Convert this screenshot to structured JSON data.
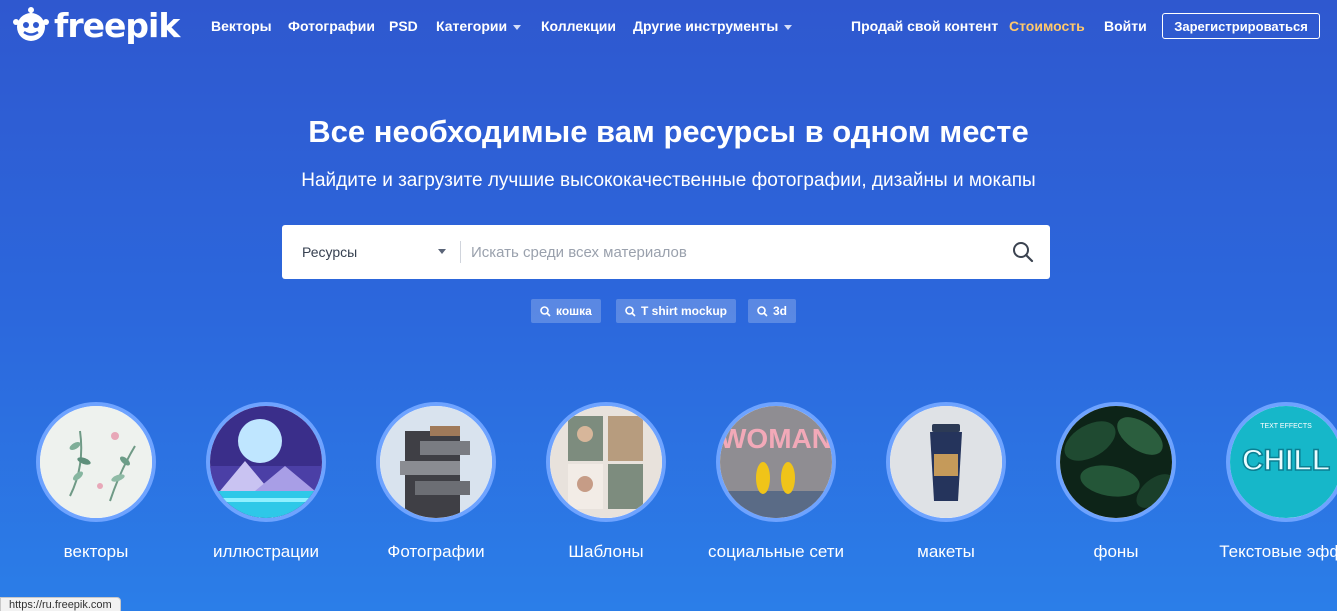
{
  "brand": {
    "name": "freepik"
  },
  "nav": {
    "vectors": "Векторы",
    "photos": "Фотографии",
    "psd": "PSD",
    "categories": "Категории",
    "collections": "Коллекции",
    "other_tools": "Другие инструменты",
    "sell": "Продай свой контент",
    "price": "Стоимость",
    "login": "Войти",
    "register": "Зарегистрироваться"
  },
  "hero": {
    "title": "Все необходимые вам ресурсы в одном месте",
    "subtitle": "Найдите и загрузите лучшие высококачественные фотографии, дизайны и мокапы"
  },
  "search": {
    "type_selected": "Ресурсы",
    "placeholder": "Искать среди всех материалов"
  },
  "tags": [
    "кошка",
    "T shirt mockup",
    "3d"
  ],
  "categories": [
    {
      "label": "векторы"
    },
    {
      "label": "иллюстрации"
    },
    {
      "label": "Фотографии"
    },
    {
      "label": "Шаблоны"
    },
    {
      "label": "социальные сети",
      "thumb_text": "WOMAN"
    },
    {
      "label": "макеты"
    },
    {
      "label": "фоны"
    },
    {
      "label": "Текстовые эффе",
      "thumb_text": "CHILL",
      "thumb_small": "TEXT EFFECTS"
    }
  ],
  "statusbar": {
    "url": "https://ru.freepik.com"
  },
  "colors": {
    "accent": "#2c67dc",
    "price": "#ffc86b",
    "ring": "#6ea3ff"
  }
}
